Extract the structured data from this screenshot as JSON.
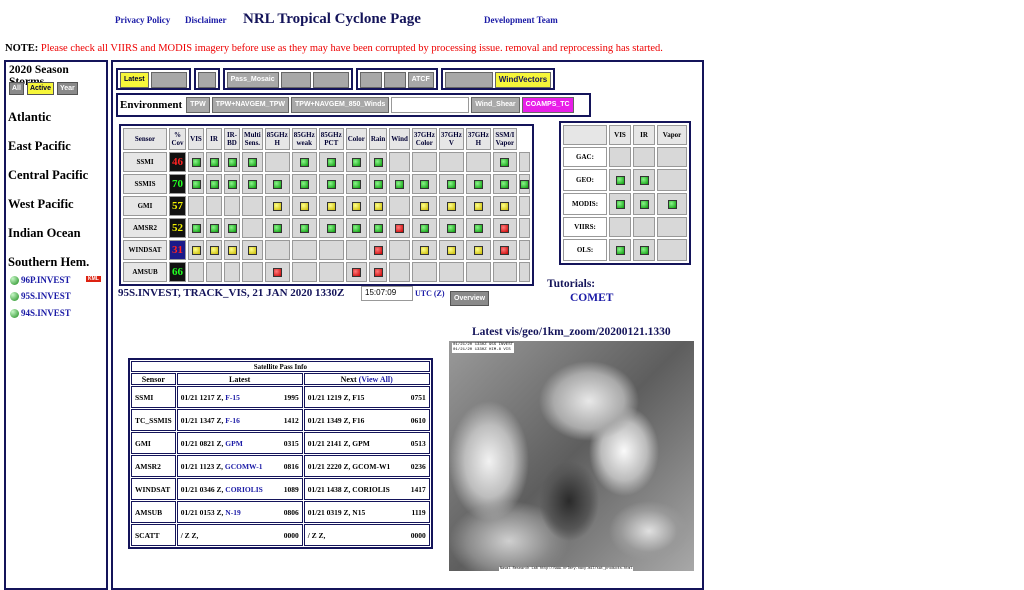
{
  "header": {
    "privacy": "Privacy Policy",
    "disclaimer": "Disclaimer",
    "title": "NRL Tropical Cyclone Page",
    "devteam": "Development Team"
  },
  "note": {
    "label": "NOTE:",
    "text": "Please check all VIIRS and MODIS imagery before use as they may have been corrupted by processing issue. removal and reprocessing has started."
  },
  "sidebar": {
    "title": "2020 Season Storms",
    "tabs": [
      "All",
      "Active",
      "Year"
    ],
    "basins": [
      "Atlantic",
      "East Pacific",
      "Central Pacific",
      "West Pacific",
      "Indian Ocean",
      "Southern Hem."
    ],
    "storms": [
      "96P.INVEST",
      "95S.INVEST",
      "94S.INVEST"
    ],
    "kml": "KML"
  },
  "toolbar": {
    "latest": "Latest",
    "pass_mosaic": "Pass_Mosaic",
    "atcf": "ATCF",
    "windvectors": "WindVectors"
  },
  "environment": {
    "label": "Environment",
    "buttons": [
      "TPW",
      "TPW+NAVGEM_TPW",
      "TPW+NAVGEM_850_Winds"
    ],
    "wind_shear": "Wind_Shear",
    "coamps": "COAMPS_TC"
  },
  "sensor_table": {
    "headers": [
      "Sensor",
      "% Cov",
      "VIS",
      "IR",
      "IR-BD",
      "Multi Sens.",
      "85GHz H",
      "85GHz weak",
      "85GHz PCT",
      "Color",
      "Rain",
      "Wind",
      "37GHz Color",
      "37GHz V",
      "37GHz H",
      "SSM/I Vapor"
    ],
    "rows": [
      {
        "name": "SSMI",
        "cov": "46",
        "cells": [
          "g",
          "g",
          "g",
          "g",
          "",
          "g",
          "g",
          "g",
          "g",
          "",
          "",
          "",
          "",
          "g",
          ""
        ]
      },
      {
        "name": "SSMIS",
        "cov": "70",
        "cells": [
          "g",
          "g",
          "g",
          "g",
          "g",
          "g",
          "g",
          "g",
          "g",
          "g",
          "g",
          "g",
          "g",
          "g",
          "g"
        ]
      },
      {
        "name": "GMI",
        "cov": "57",
        "cells": [
          "",
          "",
          "",
          "",
          "y",
          "y",
          "y",
          "y",
          "y",
          "",
          "y",
          "y",
          "y",
          "y",
          ""
        ]
      },
      {
        "name": "AMSR2",
        "cov": "52",
        "cells": [
          "g",
          "g",
          "g",
          "",
          "g",
          "g",
          "g",
          "g",
          "g",
          "r",
          "g",
          "g",
          "g",
          "r",
          ""
        ]
      },
      {
        "name": "WINDSAT",
        "cov": "31",
        "cells": [
          "y",
          "y",
          "y",
          "y",
          "",
          "",
          "",
          "",
          "r",
          "",
          "y",
          "y",
          "y",
          "r",
          ""
        ]
      },
      {
        "name": "AMSUB",
        "cov": "66",
        "cells": [
          "",
          "",
          "",
          "",
          "r",
          "",
          "",
          "r",
          "r",
          "",
          "",
          "",
          "",
          "",
          ""
        ]
      }
    ]
  },
  "other_table": {
    "headers": [
      "",
      "VIS",
      "IR",
      "Vapor"
    ],
    "rows": [
      {
        "name": "GAC:",
        "cells": [
          "",
          "",
          ""
        ]
      },
      {
        "name": "GEO:",
        "cells": [
          "g",
          "g",
          ""
        ]
      },
      {
        "name": "MODIS:",
        "cells": [
          "g",
          "g",
          "g"
        ]
      },
      {
        "name": "VIIRS:",
        "cells": [
          "",
          "",
          ""
        ]
      },
      {
        "name": "OLS:",
        "cells": [
          "g",
          "g",
          ""
        ]
      }
    ]
  },
  "storm_info": {
    "label": "95S.INVEST, TRACK_VIS, 21 JAN 2020 1330Z",
    "time": "15:07:09",
    "utc": "UTC (Z)",
    "overview": "Overview"
  },
  "tutorials": {
    "label": "Tutorials:",
    "comet": "COMET"
  },
  "image": {
    "title": "Latest vis/geo/1km_zoom/20200121.1330",
    "hdr1": "01/21/20 1330Z  95S INVEST",
    "hdr2": "01/21/20 1330Z  HIM-8 VIS",
    "footer": "Naval Research Lab  http://www.nrlmry.navy.mil/sat_products.html"
  },
  "pass_info": {
    "caption": "Satellite Pass Info",
    "col_sensor": "Sensor",
    "col_latest": "Latest",
    "col_next": "Next",
    "view_all": "(View All)",
    "rows": [
      {
        "sensor": "SSMI",
        "latest": "01/21 1217 Z,",
        "latest_sat": "F-15",
        "latest_num": "1995",
        "next": "01/21 1219 Z,",
        "next_sat": "F15",
        "next_num": "0751"
      },
      {
        "sensor": "TC_SSMIS",
        "latest": "01/21 1347 Z,",
        "latest_sat": "F-16",
        "latest_num": "1412",
        "next": "01/21 1349 Z,",
        "next_sat": "F16",
        "next_num": "0610"
      },
      {
        "sensor": "GMI",
        "latest": "01/21 0821 Z,",
        "latest_sat": "GPM",
        "latest_num": "0315",
        "next": "01/21 2141 Z,",
        "next_sat": "GPM",
        "next_num": "0513"
      },
      {
        "sensor": "AMSR2",
        "latest": "01/21 1123 Z,",
        "latest_sat": "GCOMW-1",
        "latest_num": "0816",
        "next": "01/21 2220 Z,",
        "next_sat": "GCOM-W1",
        "next_num": "0236"
      },
      {
        "sensor": "WINDSAT",
        "latest": "01/21 0346 Z,",
        "latest_sat": "CORIOLIS",
        "latest_num": "1089",
        "next": "01/21 1438 Z,",
        "next_sat": "CORIOLIS",
        "next_num": "1417"
      },
      {
        "sensor": "AMSUB",
        "latest": "01/21 0153 Z,",
        "latest_sat": "N-19",
        "latest_num": "0806",
        "next": "01/21 0319 Z,",
        "next_sat": "N15",
        "next_num": "1119"
      },
      {
        "sensor": "SCATT",
        "latest": "/ Z Z,",
        "latest_sat": "",
        "latest_num": "0000",
        "next": "/ Z Z,",
        "next_sat": "",
        "next_num": "0000"
      }
    ]
  }
}
